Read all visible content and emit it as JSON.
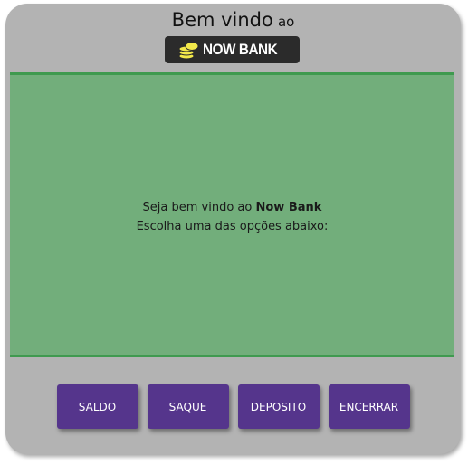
{
  "header": {
    "title_main": "Bem vindo",
    "title_suffix": "ao"
  },
  "logo": {
    "text": "NOW BANK",
    "icon": "coins-icon",
    "icon_color": "#f2e84a"
  },
  "screen": {
    "line1_prefix": "Seja bem vindo ao ",
    "line1_bold": "Now Bank",
    "line2": "Escolha uma das opções abaixo:"
  },
  "buttons": [
    {
      "label": "SALDO"
    },
    {
      "label": "SAQUE"
    },
    {
      "label": "DEPOSITO"
    },
    {
      "label": "ENCERRAR"
    }
  ],
  "colors": {
    "frame": "#b3b3b3",
    "screen": "#72ae7b",
    "screen_border": "#3f9a4f",
    "button": "#55358c",
    "logo_bg": "#2b2b2b"
  }
}
